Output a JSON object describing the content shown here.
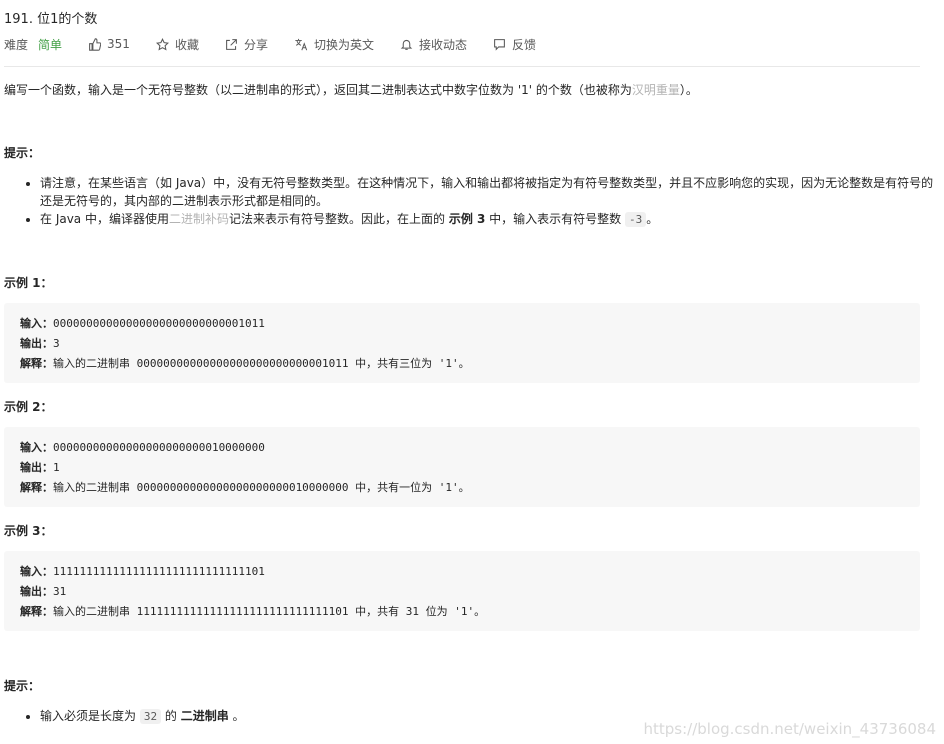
{
  "problem": {
    "title": "191. 位1的个数"
  },
  "meta": {
    "difficulty_label": "难度",
    "difficulty": "简单",
    "likes": "351",
    "favorite": "收藏",
    "share": "分享",
    "switch_lang": "切换为英文",
    "follow": "接收动态",
    "feedback": "反馈"
  },
  "description": {
    "before": "编写一个函数，输入是一个无符号整数（以二进制串的形式），返回其二进制表达式中数字位数为 '1' 的个数（也被称为",
    "link": "汉明重量",
    "after": "）。"
  },
  "hints1": {
    "heading": "提示：",
    "items": [
      "请注意，在某些语言（如 Java）中，没有无符号整数类型。在这种情况下，输入和输出都将被指定为有符号整数类型，并且不应影响您的实现，因为无论整数是有符号的还是无符号的，其内部的二进制表示形式都是相同的。"
    ],
    "item2": {
      "a": "在 Java 中，编译器使用",
      "link": "二进制补码",
      "b": "记法来表示有符号整数。因此，在上面的 ",
      "bold": "示例 3",
      "c": " 中，输入表示有符号整数 ",
      "code": "-3",
      "d": "。"
    }
  },
  "examples": [
    {
      "heading": "示例 1：",
      "input_label": "输入：",
      "input": "00000000000000000000000000001011",
      "output_label": "输出：",
      "output": "3",
      "explain_label": "解释：",
      "explain": "输入的二进制串 00000000000000000000000000001011 中，共有三位为 '1'。"
    },
    {
      "heading": "示例 2：",
      "input_label": "输入：",
      "input": "00000000000000000000000010000000",
      "output_label": "输出：",
      "output": "1",
      "explain_label": "解释：",
      "explain": "输入的二进制串 00000000000000000000000010000000 中，共有一位为 '1'。"
    },
    {
      "heading": "示例 3：",
      "input_label": "输入：",
      "input": "11111111111111111111111111111101",
      "output_label": "输出：",
      "output": "31",
      "explain_label": "解释：",
      "explain": "输入的二进制串 11111111111111111111111111111101 中，共有 31 位为 '1'。"
    }
  ],
  "hints2": {
    "heading": "提示：",
    "item": {
      "a": "输入必须是长度为 ",
      "code": "32",
      "b": " 的 ",
      "bold": "二进制串",
      "c": " 。"
    }
  },
  "watermark": "https://blog.csdn.net/weixin_43736084"
}
